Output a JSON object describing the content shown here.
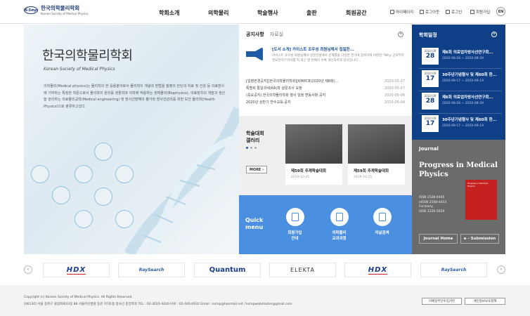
{
  "header": {
    "logo_mark": "K-Smp",
    "logo_ko": "한국의학물리학회",
    "logo_en": "Korean Society of Medical Physics",
    "nav": [
      "학회소개",
      "의학물리",
      "학술행사",
      "출판",
      "회원공간"
    ],
    "util": [
      "마이페이지",
      "로그아웃",
      "로그인",
      "회원가입"
    ],
    "lang": "EN"
  },
  "hero": {
    "title": "한국의학물리학회",
    "subtitle": "Korean Society of Medical Physics",
    "desc": "의학물리(Medical physics)는 물리학의 한 응용분야로서 물리학의 개념과 방법을 질병의 진단과 치료 및 건강 등 의료방사에 기여하는 특정한 학문으로서 물리학의 원리를 생활학과 의학에 적용하는 생체물리(Biophysics), 의료장치의 개발과 생산을 관리하는 의료물리공학(Medical engineering) 및 방사선장해의 평가와 방사선관리를 위한 보건 물리학(Health Physics)으로 분류하고있다."
  },
  "notice": {
    "tab_active": "공지사항",
    "tab_other": "자료실",
    "featured_title": "[도서 소개] 카이스트 조우성 회원님께서 집필한...",
    "featured_desc": "카이스트 조우성 회원님께서 방문인원에서 문제를을 다양한 연가에 집위하여 비판한 \"Why 공직부터 필요한가?\"라이를 저 최근 말 반에이 수록 개인과학과 당사입니다...",
    "items": [
      {
        "title": "[일정변경공지][한국의학물리학회][KMPC8(2020년 제8회)...",
        "date": "2020-05-07"
      },
      {
        "title": "특별회 통일과세(KA)학 설문조사 요청",
        "date": "2020-05-07"
      },
      {
        "title": "(중요공지) 한국의학물리학회 행사 일정 변동사항 공지",
        "date": "2020-05-06"
      },
      {
        "title": "2020년 상반기 연수교육 공지",
        "date": "2020-05-04"
      }
    ]
  },
  "gallery": {
    "title_line1": "학술대회",
    "title_line2": "갤러리",
    "more": "MORE",
    "cards": [
      {
        "title": "제59회 추계학술대회",
        "date": "2019-10-25"
      },
      {
        "title": "제59회 추계학술대회",
        "date": "2019-10-25"
      }
    ]
  },
  "quick": {
    "title_line1": "Quick",
    "title_line2": "menu",
    "items": [
      {
        "line1": "회원가입",
        "line2": "안내"
      },
      {
        "line1": "의학물리",
        "line2": "교과과정"
      },
      {
        "line1": "저널검색",
        "line2": ""
      }
    ]
  },
  "academic": {
    "title": "학회일정",
    "events": [
      {
        "ym": "2020.08",
        "day": "28",
        "title": "제6회 의료업자방사선연구회...",
        "range": "2020-08-28 ~ 2020-08-29"
      },
      {
        "ym": "2020.09",
        "day": "17",
        "title": "30주년기념행사 및 제60회 한...",
        "range": "2020-09-17 ~ 2020-09-19"
      },
      {
        "ym": "2020.08",
        "day": "28",
        "title": "제6회 의료업자방사선연구회...",
        "range": "2020-08-28 ~ 2020-08-29"
      },
      {
        "ym": "2020.09",
        "day": "17",
        "title": "30주년기념행사 및 제60회 한...",
        "range": "2020-09-17 ~ 2020-09-19"
      }
    ]
  },
  "journal": {
    "label": "Journal",
    "name_line1": "Progress in Medical",
    "name_line2": "Physics",
    "issn": [
      "ISSN 2508-4445",
      "eISSN 2508-4453",
      "Formerly",
      "ISSN 1226-5829"
    ],
    "cover_text": "Progress in Medical Physics",
    "btn_home": "Journal Home",
    "btn_submit": "e - Submission"
  },
  "partners": [
    "HDX",
    "RaySearch",
    "Quantum",
    "ELEKTA",
    "HDX",
    "RaySearch"
  ],
  "footer": {
    "copyright": "Copyright (c) Korean Society of Medical Physics. All Rights Reserved.",
    "address": "[06130] 서울 송파구 올림픽로43길 88 서울아산병원 동관 지하1층 방사선 종양학과   TEL : 02-3010-4426   FAX : 02-440-6932   Email : ksmp@hanmail.net / ksmpwebmaster@gmail.com",
    "btn1": "이메일무단수집거부",
    "btn2": "개인정보보호정책"
  }
}
